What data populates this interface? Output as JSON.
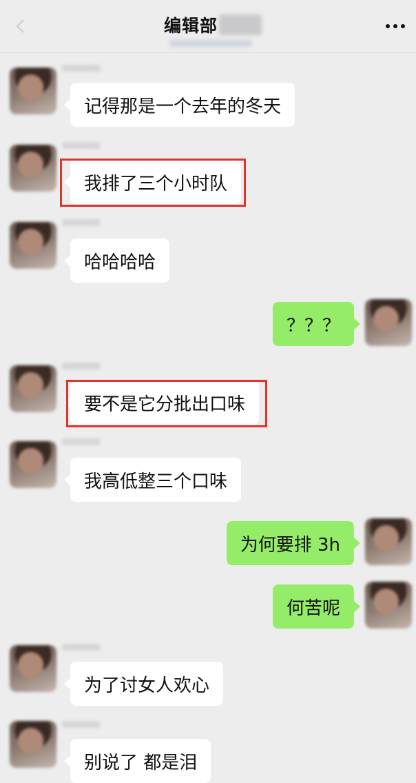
{
  "header": {
    "title": "编辑部"
  },
  "messages": [
    {
      "side": "in",
      "text": "记得那是一个去年的冬天",
      "highlighted": false
    },
    {
      "side": "in",
      "text": "我排了三个小时队",
      "highlighted": true
    },
    {
      "side": "in",
      "text": "哈哈哈哈",
      "highlighted": false
    },
    {
      "side": "out",
      "text": "？？？",
      "highlighted": false
    },
    {
      "side": "in",
      "text": "要不是它分批出口味",
      "highlighted": true
    },
    {
      "side": "in",
      "text": "我高低整三个口味",
      "highlighted": false
    },
    {
      "side": "out",
      "text": "为何要排 3h",
      "highlighted": false
    },
    {
      "side": "out",
      "text": "何苦呢",
      "highlighted": false
    },
    {
      "side": "in",
      "text": "为了讨女人欢心",
      "highlighted": false
    },
    {
      "side": "in",
      "text": "别说了 都是泪",
      "highlighted": false
    }
  ],
  "colors": {
    "background": "#ededed",
    "incoming_bubble": "#ffffff",
    "outgoing_bubble": "#95ec69",
    "highlight_border": "#e0342a"
  }
}
